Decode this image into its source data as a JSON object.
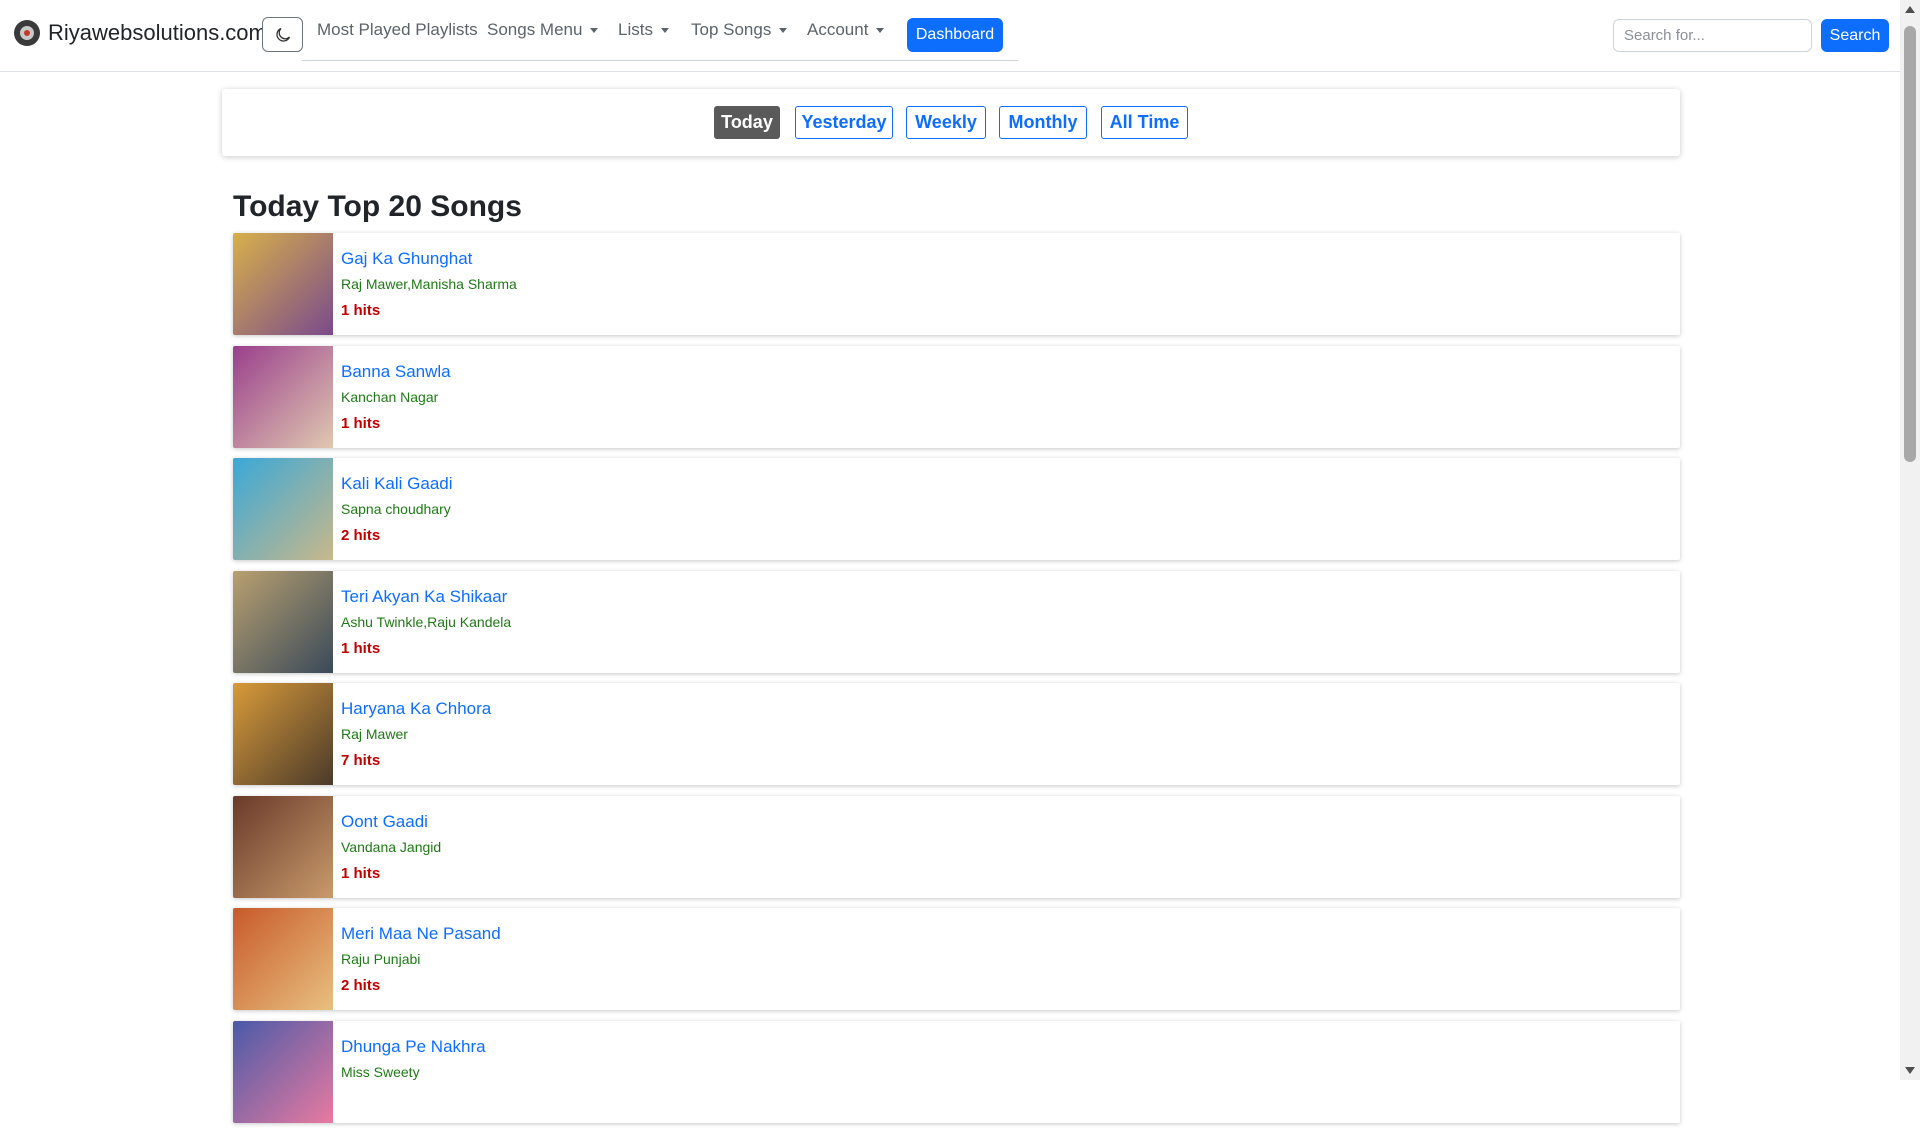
{
  "brand": {
    "name": "Riyawebsolutions.com",
    "logo_icon": "vinyl-record-icon"
  },
  "theme_toggle": {
    "icon": "moon-icon"
  },
  "nav": {
    "items": [
      {
        "label": "Most Played Playlists",
        "dropdown": false
      },
      {
        "label": "Songs Menu",
        "dropdown": true
      },
      {
        "label": "Lists",
        "dropdown": true
      },
      {
        "label": "Top Songs",
        "dropdown": true
      },
      {
        "label": "Account",
        "dropdown": true
      }
    ],
    "dashboard_label": "Dashboard"
  },
  "search": {
    "placeholder": "Search for...",
    "value": "",
    "button_label": "Search"
  },
  "filters": {
    "items": [
      {
        "label": "Today",
        "active": true
      },
      {
        "label": "Yesterday",
        "active": false
      },
      {
        "label": "Weekly",
        "active": false
      },
      {
        "label": "Monthly",
        "active": false
      },
      {
        "label": "All Time",
        "active": false
      }
    ]
  },
  "section": {
    "title": "Today Top 20 Songs"
  },
  "songs": [
    {
      "title": "Gaj Ka Ghunghat",
      "artist": "Raj Mawer,Manisha Sharma",
      "hits": "1 hits",
      "thumb_colors": [
        "#d8b04a",
        "#7a4a8c"
      ]
    },
    {
      "title": "Banna Sanwla",
      "artist": "Kanchan Nagar",
      "hits": "1 hits",
      "thumb_colors": [
        "#9a3f8c",
        "#e0c8b0"
      ]
    },
    {
      "title": "Kali Kali Gaadi",
      "artist": "Sapna choudhary",
      "hits": "2 hits",
      "thumb_colors": [
        "#3aa8d8",
        "#c8b88a"
      ]
    },
    {
      "title": "Teri Akyan Ka Shikaar",
      "artist": "Ashu Twinkle,Raju Kandela",
      "hits": "1 hits",
      "thumb_colors": [
        "#b8a070",
        "#3a4a5a"
      ]
    },
    {
      "title": "Haryana Ka Chhora",
      "artist": "Raj Mawer",
      "hits": "7 hits",
      "thumb_colors": [
        "#d89a3a",
        "#4a3a2a"
      ]
    },
    {
      "title": "Oont Gaadi",
      "artist": "Vandana Jangid",
      "hits": "1 hits",
      "thumb_colors": [
        "#6a3a2a",
        "#c89a6a"
      ]
    },
    {
      "title": "Meri Maa Ne Pasand",
      "artist": "Raju Punjabi",
      "hits": "2 hits",
      "thumb_colors": [
        "#c85a2a",
        "#e8c080"
      ]
    },
    {
      "title": "Dhunga Pe Nakhra",
      "artist": "Miss Sweety",
      "hits": "",
      "thumb_colors": [
        "#4a5aa8",
        "#e87aa0"
      ]
    }
  ]
}
